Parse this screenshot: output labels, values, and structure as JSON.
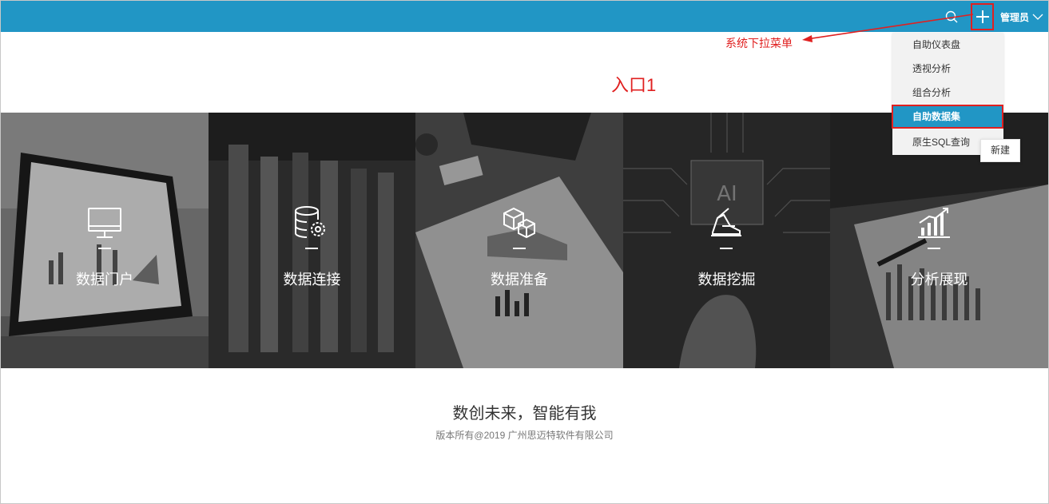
{
  "header": {
    "user_label": "管理员",
    "icons": [
      "search-icon",
      "plus-icon",
      "chevron-down-icon"
    ]
  },
  "dropdown": {
    "items": [
      {
        "label": "自助仪表盘"
      },
      {
        "label": "透视分析"
      },
      {
        "label": "组合分析"
      },
      {
        "label": "自助数据集",
        "active": true
      },
      {
        "label": "原生SQL查询"
      }
    ],
    "tooltip": "新建"
  },
  "annotation": {
    "text": "系统下拉菜单",
    "entry_title": "入口1",
    "color": "#e02020"
  },
  "tiles": [
    {
      "label": "数据门户",
      "icon": "monitor-icon"
    },
    {
      "label": "数据连接",
      "icon": "database-gear-icon"
    },
    {
      "label": "数据准备",
      "icon": "cubes-icon"
    },
    {
      "label": "数据挖掘",
      "icon": "mining-icon"
    },
    {
      "label": "分析展现",
      "icon": "bar-chart-icon"
    }
  ],
  "footer": {
    "slogan": "数创未来，智能有我",
    "copyright": "版本所有@2019 广州思迈特软件有限公司"
  },
  "colors": {
    "topbar": "#2196c5",
    "highlight": "#e02020"
  }
}
